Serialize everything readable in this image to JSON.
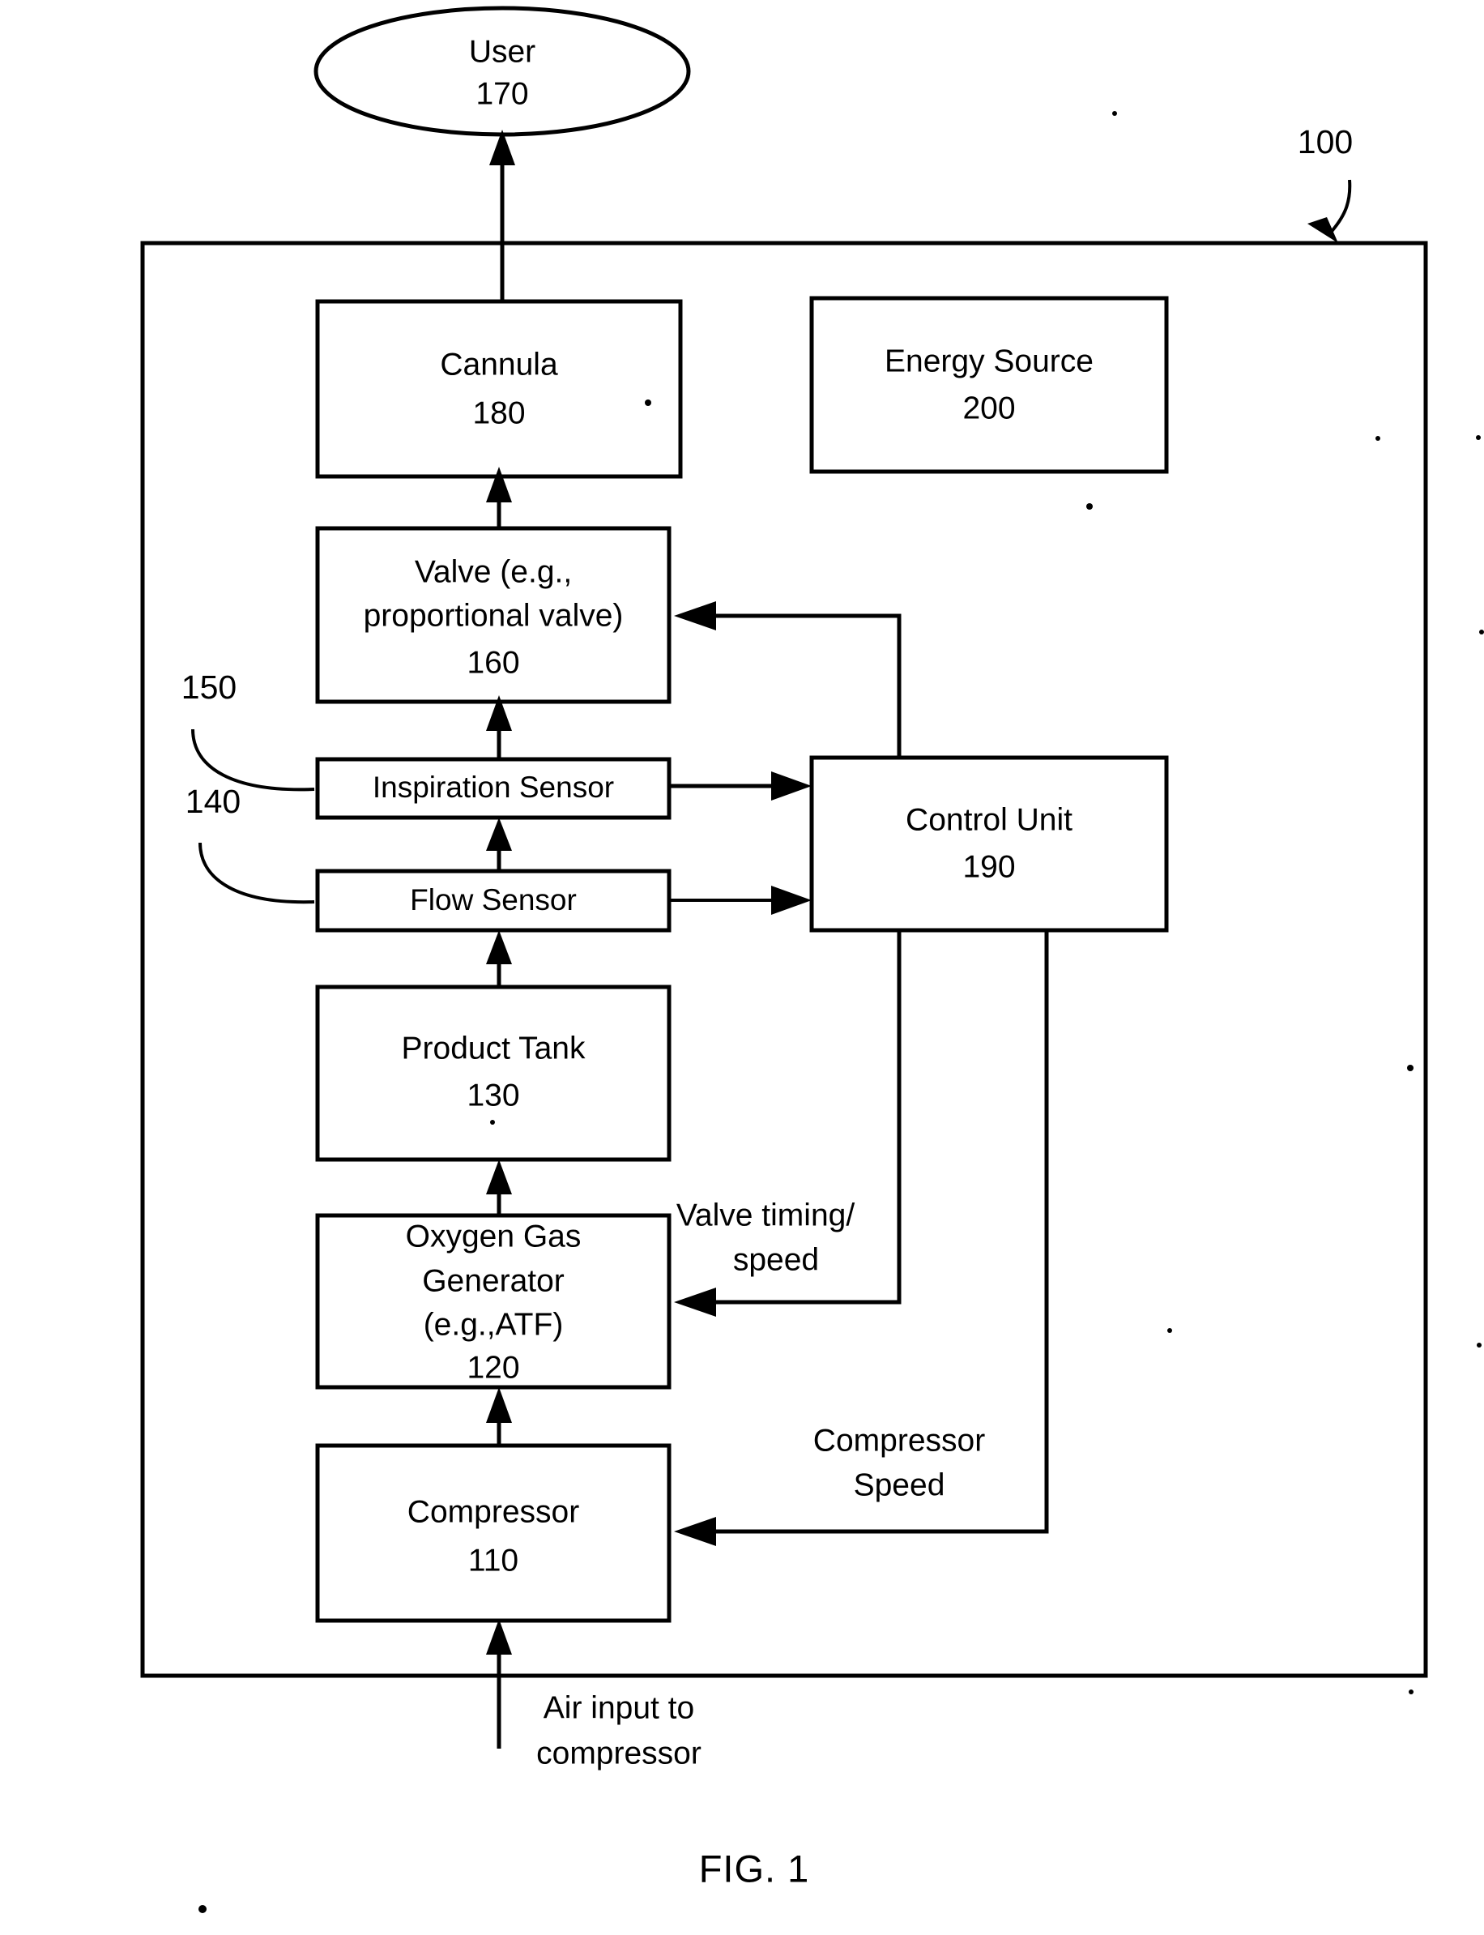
{
  "figure": {
    "caption": "FIG. 1",
    "system_ref": "100"
  },
  "nodes": {
    "user": {
      "label": "User",
      "ref": "170",
      "shape": "ellipse"
    },
    "cannula": {
      "label": "Cannula",
      "ref": "180",
      "shape": "rect"
    },
    "energy_source": {
      "label": "Energy Source",
      "ref": "200",
      "shape": "rect"
    },
    "valve": {
      "label_line1": "Valve (e.g.,",
      "label_line2": "proportional valve)",
      "ref": "160",
      "shape": "rect"
    },
    "inspiration_sensor": {
      "label": "Inspiration Sensor",
      "ref": "150",
      "shape": "rect"
    },
    "flow_sensor": {
      "label": "Flow Sensor",
      "ref": "140",
      "shape": "rect"
    },
    "control_unit": {
      "label": "Control Unit",
      "ref": "190",
      "shape": "rect"
    },
    "product_tank": {
      "label": "Product Tank",
      "ref": "130",
      "shape": "rect"
    },
    "oxygen_generator": {
      "label_line1": "Oxygen Gas",
      "label_line2": "Generator",
      "label_line3": "(e.g.,ATF)",
      "ref": "120",
      "shape": "rect"
    },
    "compressor": {
      "label": "Compressor",
      "ref": "110",
      "shape": "rect"
    }
  },
  "edge_labels": {
    "valve_timing_line1": "Valve timing/",
    "valve_timing_line2": "speed",
    "compressor_speed_line1": "Compressor",
    "compressor_speed_line2": "Speed",
    "air_input_line1": "Air input to",
    "air_input_line2": "compressor"
  },
  "colors": {
    "stroke": "#000000",
    "fill": "#ffffff",
    "background": "#ffffff"
  }
}
